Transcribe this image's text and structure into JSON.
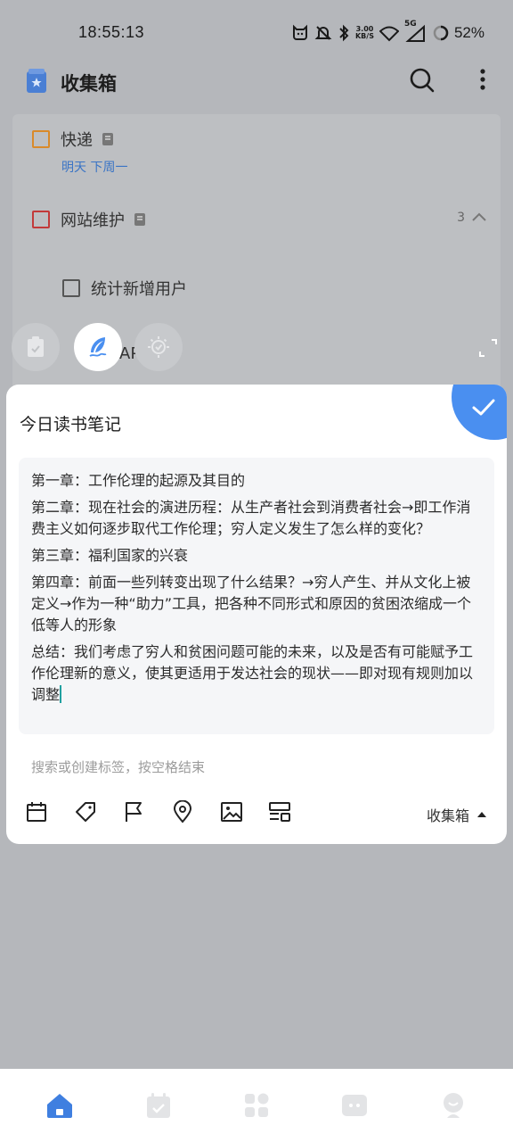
{
  "status_bar": {
    "time": "18:55:13",
    "speed_value": "3.00",
    "speed_unit": "KB/S",
    "network": "5G",
    "battery": "52%"
  },
  "header": {
    "title": "收集箱",
    "folder_icon": "inbox-folder-icon",
    "accent": "#4a7fd4"
  },
  "tasks": [
    {
      "label": "快递",
      "checkbox_color": "#d98a2a",
      "date": "明天 下周一"
    },
    {
      "label": "网站维护",
      "checkbox_color": "#c23a3a",
      "subtask_count": "3"
    },
    {
      "label": "统计新增用户",
      "checkbox_color": "#555555"
    },
    {
      "label": "API",
      "checkbox_color": "#c23a3a"
    }
  ],
  "editor": {
    "title": "今日读书笔记",
    "paragraphs": [
      "第一章：工作伦理的起源及其目的",
      "第二章：现在社会的演进历程：从生产者社会到消费者社会→即工作消费主义如何逐步取代工作伦理；穷人定义发生了怎么样的变化？",
      "第三章：福利国家的兴衰",
      "第四章：前面一些列转变出现了什么结果？→穷人产生、并从文化上被定义→作为一种“助力”工具，把各种不同形式和原因的贫困浓缩成一个低等人的形象",
      "总结：我们考虑了穷人和贫困问题可能的未来，以及是否有可能赋予工作伦理新的意义，使其更适用于发达社会的现状——即对现有规则加以调整"
    ],
    "tag_placeholder": "搜索或创建标签，按空格结束",
    "project": "收集箱",
    "confirm_color": "#4a8ff0"
  },
  "bottom_nav": {
    "items": [
      "home-icon",
      "calendar-icon",
      "apps-grid-icon",
      "focus-icon",
      "profile-icon"
    ],
    "active_color": "#3f7fe0"
  }
}
